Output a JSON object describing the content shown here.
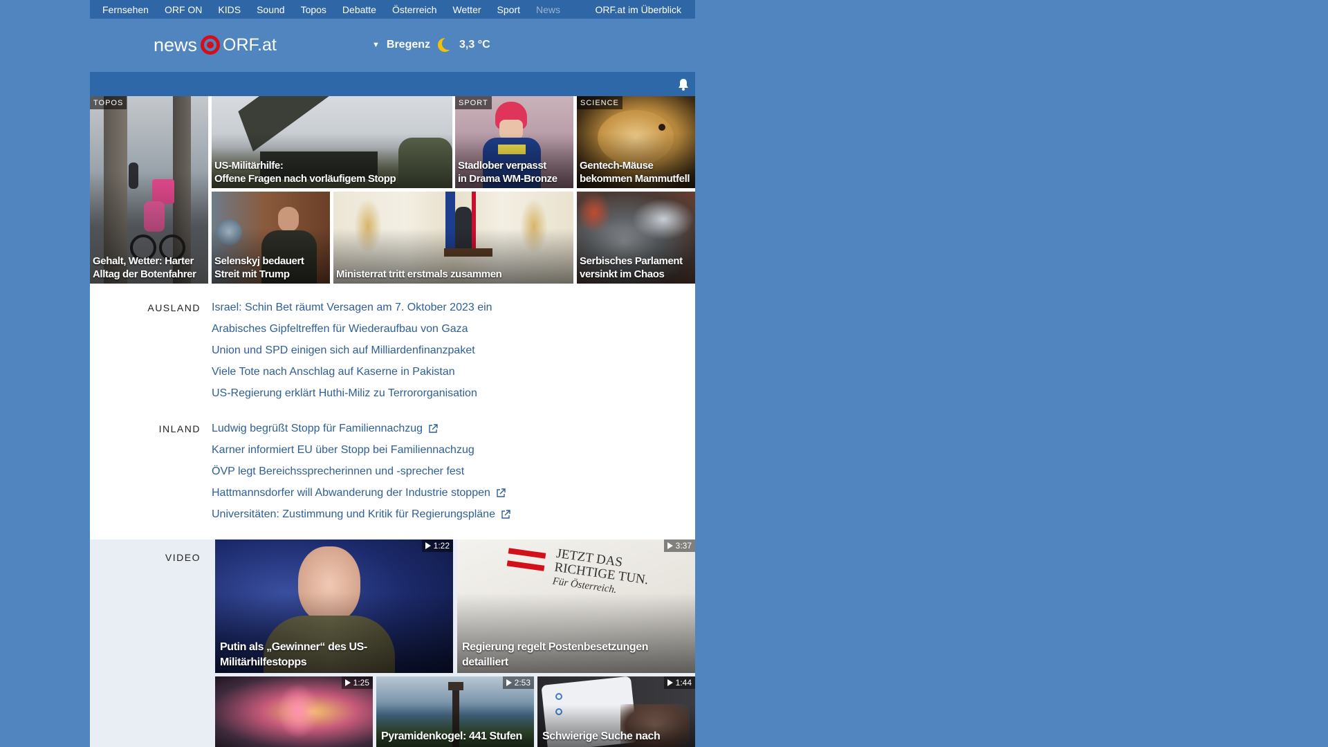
{
  "nav": {
    "items": [
      {
        "label": "Fernsehen"
      },
      {
        "label": "ORF ON"
      },
      {
        "label": "KIDS"
      },
      {
        "label": "Sound"
      },
      {
        "label": "Topos"
      },
      {
        "label": "Debatte"
      },
      {
        "label": "Österreich"
      },
      {
        "label": "Wetter"
      },
      {
        "label": "Sport"
      },
      {
        "label": "News"
      }
    ],
    "overview": "ORF.at im Überblick"
  },
  "logo": {
    "news": "news",
    "orf": "ORF.at"
  },
  "weather": {
    "city": "Bregenz",
    "temp": "3,3 °C",
    "icon": "moon-icon"
  },
  "colors": {
    "background": "#5085c0",
    "nav": "#2e66a6",
    "link": "#2e5f94",
    "logo_red": "#d3101a"
  },
  "tiles": [
    {
      "category": "TOPOS",
      "title": "Gehalt, Wetter: Harter\nAlltag der Botenfahrer"
    },
    {
      "category": "",
      "title": "US-Militärhilfe:\nOffene Fragen nach vorläufigem Stopp"
    },
    {
      "category": "SPORT",
      "title": "Stadlober verpasst\nin Drama WM-Bronze"
    },
    {
      "category": "SCIENCE",
      "title": "Gentech-Mäuse\nbekommen Mammutfell"
    },
    {
      "category": "",
      "title": "Selenskyj bedauert\nStreit mit Trump"
    },
    {
      "category": "",
      "title": "Ministerrat tritt erstmals zusammen"
    },
    {
      "category": "",
      "title": "Serbisches Parlament\nversinkt im Chaos"
    }
  ],
  "ausland": {
    "label": "AUSLAND",
    "items": [
      {
        "text": "Israel: Schin Bet räumt Versagen am 7. Oktober 2023 ein"
      },
      {
        "text": "Arabisches Gipfeltreffen für Wiederaufbau von Gaza"
      },
      {
        "text": "Union und SPD einigen sich auf Milliardenfinanzpaket"
      },
      {
        "text": "Viele Tote nach Anschlag auf Kaserne in Pakistan"
      },
      {
        "text": "US-Regierung erklärt Huthi-Miliz zu Terrororganisation"
      }
    ]
  },
  "inland": {
    "label": "INLAND",
    "items": [
      {
        "text": "Ludwig begrüßt Stopp für Familiennachzug",
        "external": true
      },
      {
        "text": "Karner informiert EU über Stopp bei Familiennachzug",
        "external": false
      },
      {
        "text": "ÖVP legt Bereichssprecherinnen und -sprecher fest",
        "external": false
      },
      {
        "text": "Hattmannsdorfer will Abwanderung der Industrie stoppen",
        "external": true
      },
      {
        "text": "Universitäten: Zustimmung und Kritik für Regierungspläne",
        "external": true
      }
    ]
  },
  "video": {
    "label": "VIDEO",
    "items": [
      {
        "duration": "1:22",
        "title": "Putin als „Gewinner“ des US-\nMilitärhilfestopps"
      },
      {
        "duration": "3:37",
        "title": "Regierung regelt Postenbesetzungen\ndetailliert"
      },
      {
        "duration": "1:25",
        "title": ""
      },
      {
        "duration": "2:53",
        "title": "Pyramidenkogel: 441 Stufen"
      },
      {
        "duration": "1:44",
        "title": "Schwierige Suche nach"
      }
    ],
    "poster_text": [
      "JETZT DAS",
      "RICHTIGE TUN.",
      "Für Österreich."
    ]
  }
}
